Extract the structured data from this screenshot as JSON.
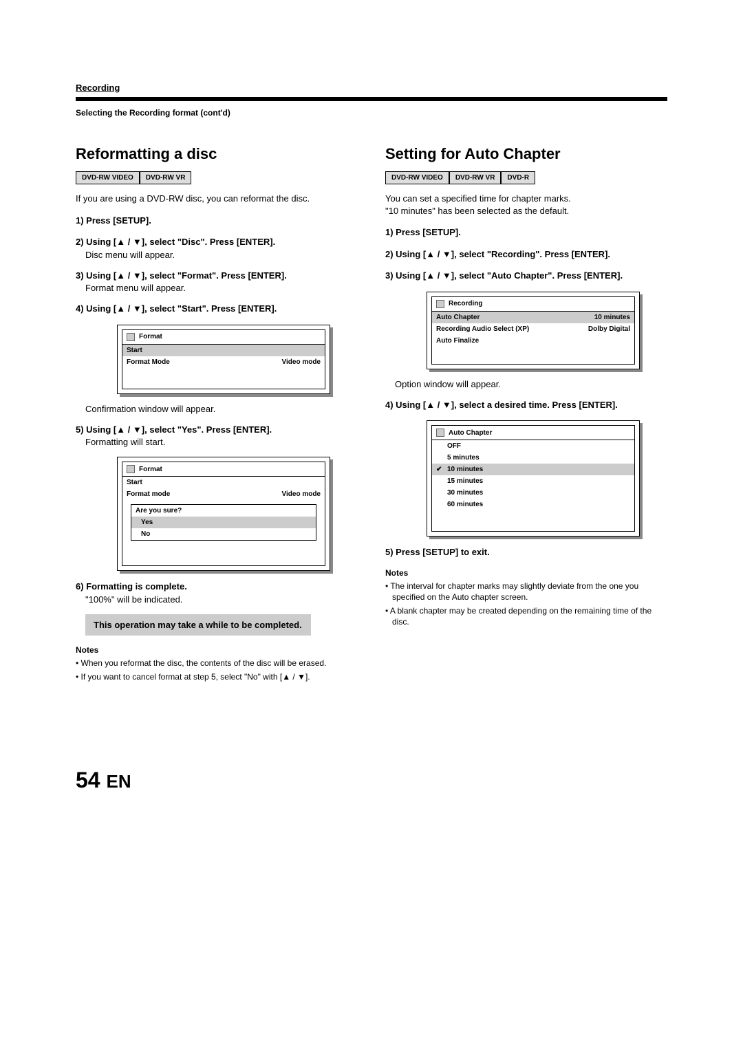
{
  "header": {
    "section": "Recording",
    "subheader": "Selecting the Recording format (cont'd)"
  },
  "left": {
    "title": "Reformatting a disc",
    "tags": [
      "DVD-RW VIDEO",
      "DVD-RW VR"
    ],
    "intro": "If you are using a DVD-RW disc, you can reformat the disc.",
    "s1": "1) Press [SETUP].",
    "s2": "2) Using [▲ / ▼], select \"Disc\". Press [ENTER].",
    "s2n": "Disc menu will appear.",
    "s3": "3) Using [▲ / ▼], select \"Format\". Press [ENTER].",
    "s3n": "Format menu will appear.",
    "s4": "4) Using [▲ / ▼], select \"Start\". Press [ENTER].",
    "osd1": {
      "title": "Format",
      "r1": "Start",
      "r2l": "Format Mode",
      "r2r": "Video mode"
    },
    "s4n": "Confirmation window will appear.",
    "s5": "5) Using [▲ / ▼], select \"Yes\". Press [ENTER].",
    "s5n": "Formatting will start.",
    "osd2": {
      "title": "Format",
      "r1": "Start",
      "r2l": "Format mode",
      "r2r": "Video mode",
      "subtitle": "Are you sure?",
      "yes": "Yes",
      "no": "No"
    },
    "s6": "6) Formatting is complete.",
    "s6n": "\"100%\" will be indicated.",
    "callout": "This operation may take a while to be completed.",
    "notes_title": "Notes",
    "note1": "• When you reformat the disc, the contents of the disc will be erased.",
    "note2": "• If you want to cancel format at step 5, select \"No\" with [▲ / ▼]."
  },
  "right": {
    "title": "Setting for Auto Chapter",
    "tags": [
      "DVD-RW VIDEO",
      "DVD-RW VR",
      "DVD-R"
    ],
    "intro1": "You can set a specified time for chapter marks.",
    "intro2": "\"10 minutes\" has been selected as the default.",
    "s1": "1) Press [SETUP].",
    "s2": "2) Using [▲ / ▼], select \"Recording\". Press [ENTER].",
    "s3": "3) Using [▲ / ▼], select \"Auto Chapter\". Press [ENTER].",
    "osd1": {
      "title": "Recording",
      "r1l": "Auto Chapter",
      "r1r": "10 minutes",
      "r2l": "Recording Audio Select (XP)",
      "r2r": "Dolby Digital",
      "r3l": "Auto Finalize"
    },
    "s3n": "Option window will appear.",
    "s4": "4) Using [▲ / ▼], select a desired time.  Press [ENTER].",
    "osd2": {
      "title": "Auto Chapter",
      "opts": [
        "OFF",
        "5 minutes",
        "10 minutes",
        "15 minutes",
        "30 minutes",
        "60 minutes"
      ]
    },
    "s5": "5) Press [SETUP] to exit.",
    "notes_title": "Notes",
    "note1": "• The interval for chapter marks may slightly deviate from the one you specified on the Auto chapter screen.",
    "note2": "• A blank chapter may be created depending on the remaining time of the disc."
  },
  "page": {
    "num": "54",
    "lang": "EN"
  }
}
